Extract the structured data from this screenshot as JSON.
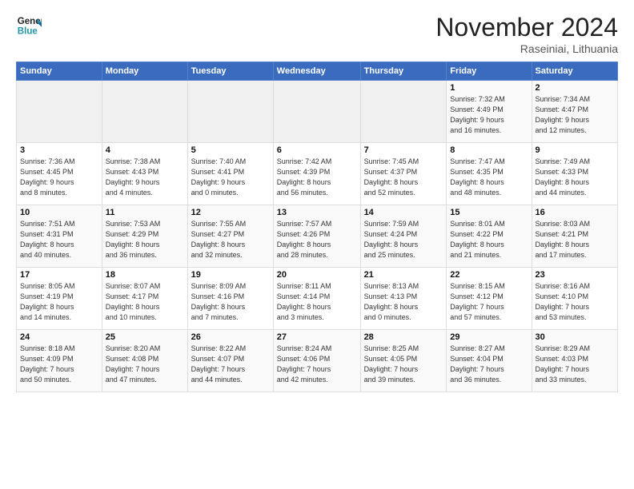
{
  "header": {
    "logo_line1": "General",
    "logo_line2": "Blue",
    "month_title": "November 2024",
    "location": "Raseiniai, Lithuania"
  },
  "days_of_week": [
    "Sunday",
    "Monday",
    "Tuesday",
    "Wednesday",
    "Thursday",
    "Friday",
    "Saturday"
  ],
  "weeks": [
    [
      {
        "day": "",
        "info": ""
      },
      {
        "day": "",
        "info": ""
      },
      {
        "day": "",
        "info": ""
      },
      {
        "day": "",
        "info": ""
      },
      {
        "day": "",
        "info": ""
      },
      {
        "day": "1",
        "info": "Sunrise: 7:32 AM\nSunset: 4:49 PM\nDaylight: 9 hours\nand 16 minutes."
      },
      {
        "day": "2",
        "info": "Sunrise: 7:34 AM\nSunset: 4:47 PM\nDaylight: 9 hours\nand 12 minutes."
      }
    ],
    [
      {
        "day": "3",
        "info": "Sunrise: 7:36 AM\nSunset: 4:45 PM\nDaylight: 9 hours\nand 8 minutes."
      },
      {
        "day": "4",
        "info": "Sunrise: 7:38 AM\nSunset: 4:43 PM\nDaylight: 9 hours\nand 4 minutes."
      },
      {
        "day": "5",
        "info": "Sunrise: 7:40 AM\nSunset: 4:41 PM\nDaylight: 9 hours\nand 0 minutes."
      },
      {
        "day": "6",
        "info": "Sunrise: 7:42 AM\nSunset: 4:39 PM\nDaylight: 8 hours\nand 56 minutes."
      },
      {
        "day": "7",
        "info": "Sunrise: 7:45 AM\nSunset: 4:37 PM\nDaylight: 8 hours\nand 52 minutes."
      },
      {
        "day": "8",
        "info": "Sunrise: 7:47 AM\nSunset: 4:35 PM\nDaylight: 8 hours\nand 48 minutes."
      },
      {
        "day": "9",
        "info": "Sunrise: 7:49 AM\nSunset: 4:33 PM\nDaylight: 8 hours\nand 44 minutes."
      }
    ],
    [
      {
        "day": "10",
        "info": "Sunrise: 7:51 AM\nSunset: 4:31 PM\nDaylight: 8 hours\nand 40 minutes."
      },
      {
        "day": "11",
        "info": "Sunrise: 7:53 AM\nSunset: 4:29 PM\nDaylight: 8 hours\nand 36 minutes."
      },
      {
        "day": "12",
        "info": "Sunrise: 7:55 AM\nSunset: 4:27 PM\nDaylight: 8 hours\nand 32 minutes."
      },
      {
        "day": "13",
        "info": "Sunrise: 7:57 AM\nSunset: 4:26 PM\nDaylight: 8 hours\nand 28 minutes."
      },
      {
        "day": "14",
        "info": "Sunrise: 7:59 AM\nSunset: 4:24 PM\nDaylight: 8 hours\nand 25 minutes."
      },
      {
        "day": "15",
        "info": "Sunrise: 8:01 AM\nSunset: 4:22 PM\nDaylight: 8 hours\nand 21 minutes."
      },
      {
        "day": "16",
        "info": "Sunrise: 8:03 AM\nSunset: 4:21 PM\nDaylight: 8 hours\nand 17 minutes."
      }
    ],
    [
      {
        "day": "17",
        "info": "Sunrise: 8:05 AM\nSunset: 4:19 PM\nDaylight: 8 hours\nand 14 minutes."
      },
      {
        "day": "18",
        "info": "Sunrise: 8:07 AM\nSunset: 4:17 PM\nDaylight: 8 hours\nand 10 minutes."
      },
      {
        "day": "19",
        "info": "Sunrise: 8:09 AM\nSunset: 4:16 PM\nDaylight: 8 hours\nand 7 minutes."
      },
      {
        "day": "20",
        "info": "Sunrise: 8:11 AM\nSunset: 4:14 PM\nDaylight: 8 hours\nand 3 minutes."
      },
      {
        "day": "21",
        "info": "Sunrise: 8:13 AM\nSunset: 4:13 PM\nDaylight: 8 hours\nand 0 minutes."
      },
      {
        "day": "22",
        "info": "Sunrise: 8:15 AM\nSunset: 4:12 PM\nDaylight: 7 hours\nand 57 minutes."
      },
      {
        "day": "23",
        "info": "Sunrise: 8:16 AM\nSunset: 4:10 PM\nDaylight: 7 hours\nand 53 minutes."
      }
    ],
    [
      {
        "day": "24",
        "info": "Sunrise: 8:18 AM\nSunset: 4:09 PM\nDaylight: 7 hours\nand 50 minutes."
      },
      {
        "day": "25",
        "info": "Sunrise: 8:20 AM\nSunset: 4:08 PM\nDaylight: 7 hours\nand 47 minutes."
      },
      {
        "day": "26",
        "info": "Sunrise: 8:22 AM\nSunset: 4:07 PM\nDaylight: 7 hours\nand 44 minutes."
      },
      {
        "day": "27",
        "info": "Sunrise: 8:24 AM\nSunset: 4:06 PM\nDaylight: 7 hours\nand 42 minutes."
      },
      {
        "day": "28",
        "info": "Sunrise: 8:25 AM\nSunset: 4:05 PM\nDaylight: 7 hours\nand 39 minutes."
      },
      {
        "day": "29",
        "info": "Sunrise: 8:27 AM\nSunset: 4:04 PM\nDaylight: 7 hours\nand 36 minutes."
      },
      {
        "day": "30",
        "info": "Sunrise: 8:29 AM\nSunset: 4:03 PM\nDaylight: 7 hours\nand 33 minutes."
      }
    ]
  ]
}
